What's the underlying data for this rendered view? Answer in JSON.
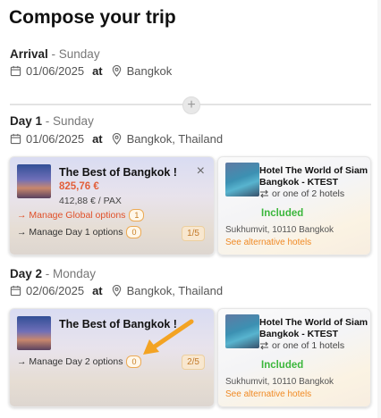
{
  "page": {
    "title": "Compose your trip"
  },
  "arrival": {
    "label": "Arrival",
    "weekday_text": " - Sunday",
    "date": "01/06/2025",
    "at": "at",
    "location": "Bangkok"
  },
  "days": [
    {
      "label": "Day 1",
      "weekday_text": " - Sunday",
      "date": "01/06/2025",
      "at": "at",
      "location": "Bangkok, Thailand",
      "activity": {
        "title": "The Best of Bangkok !",
        "price": "825,76 €",
        "per_pax": "412,88 € / PAX",
        "global_options_label": "→ Manage Global options",
        "global_options_count": "1",
        "day_options_label": "→ Manage Day 1 options",
        "day_options_count": "0",
        "pager": "1/5"
      },
      "hotel": {
        "name": "Hotel The World of Siam Bangkok - KTEST",
        "alternatives": "or one of 2 hotels",
        "status": "Included",
        "address": "Sukhumvit, 10110 Bangkok",
        "alt_link": "See alternative hotels"
      }
    },
    {
      "label": "Day 2",
      "weekday_text": " - Monday",
      "date": "02/06/2025",
      "at": "at",
      "location": "Bangkok, Thailand",
      "activity": {
        "title": "The Best of Bangkok !",
        "day_options_label": "→ Manage Day 2 options",
        "day_options_count": "0",
        "pager": "2/5"
      },
      "hotel": {
        "name": "Hotel The World of Siam Bangkok - KTEST",
        "alternatives": "or one of 1 hotels",
        "status": "Included",
        "address": "Sukhumvit, 10110 Bangkok",
        "alt_link": "See alternative hotels"
      }
    }
  ],
  "icons": {
    "calendar": "calendar-icon",
    "location": "location-pin-icon",
    "add": "plus-icon",
    "close": "close-icon",
    "swap": "swap-icon",
    "annotation": "orange-arrow-icon"
  },
  "colors": {
    "price": "#e25f3a",
    "included": "#3cb73c",
    "link": "#f08a24",
    "annotation_arrow": "#f3a323"
  }
}
